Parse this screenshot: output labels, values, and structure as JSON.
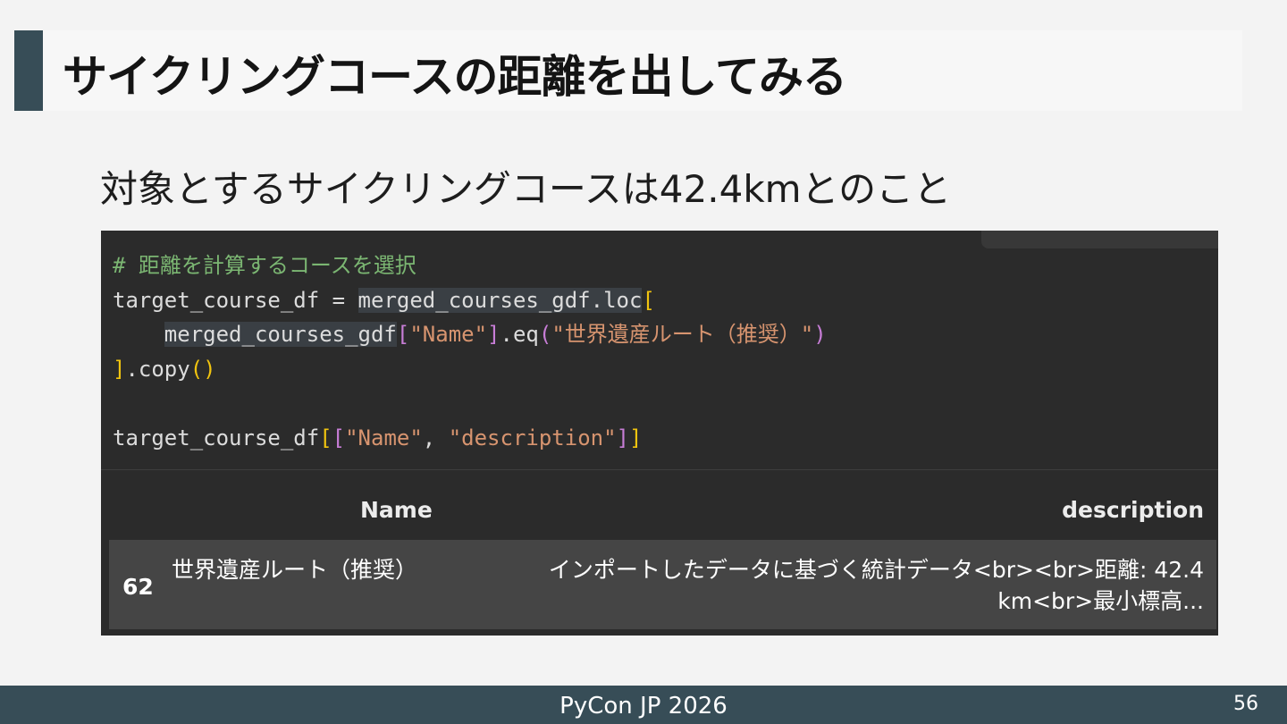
{
  "slide": {
    "title": "サイクリングコースの距離を出してみる",
    "subtitle": "対象とするサイクリングコースは42.4kmとのこと"
  },
  "code": {
    "comment": "# 距離を計算するコースを選択",
    "l2_a": "target_course_df = ",
    "l2_b": "merged_courses_gdf.loc",
    "l2_c": "[",
    "l3_indent": "    ",
    "l3_a": "merged_courses_gdf",
    "l3_b": "[",
    "l3_c": "\"Name\"",
    "l3_d": "]",
    "l3_e": ".eq",
    "l3_f": "(",
    "l3_g": "\"世界遺産ルート（推奨）\"",
    "l3_h": ")",
    "l4_a": "]",
    "l4_b": ".copy",
    "l4_c": "()",
    "l6_a": "target_course_df",
    "l6_b": "[",
    "l6_c": "[",
    "l6_d": "\"Name\"",
    "l6_e": ", ",
    "l6_f": "\"description\"",
    "l6_g": "]",
    "l6_h": "]"
  },
  "table": {
    "col_name": "Name",
    "col_desc": "description",
    "row_index": "62",
    "row_name": "世界遺産ルート（推奨）",
    "row_desc_line1": "インポートしたデータに基づく統計データ<br><br>距離: 42.4",
    "row_desc_line2": "km<br>最小標高..."
  },
  "footer": {
    "event": "PyCon JP 2026",
    "page": "56"
  },
  "colors": {
    "accent": "#374d57",
    "code_bg": "#2b2b2b",
    "comment": "#7bb672",
    "string": "#d7946f",
    "bracket_outer": "#f1c40f",
    "bracket_inner": "#c77dd6"
  }
}
